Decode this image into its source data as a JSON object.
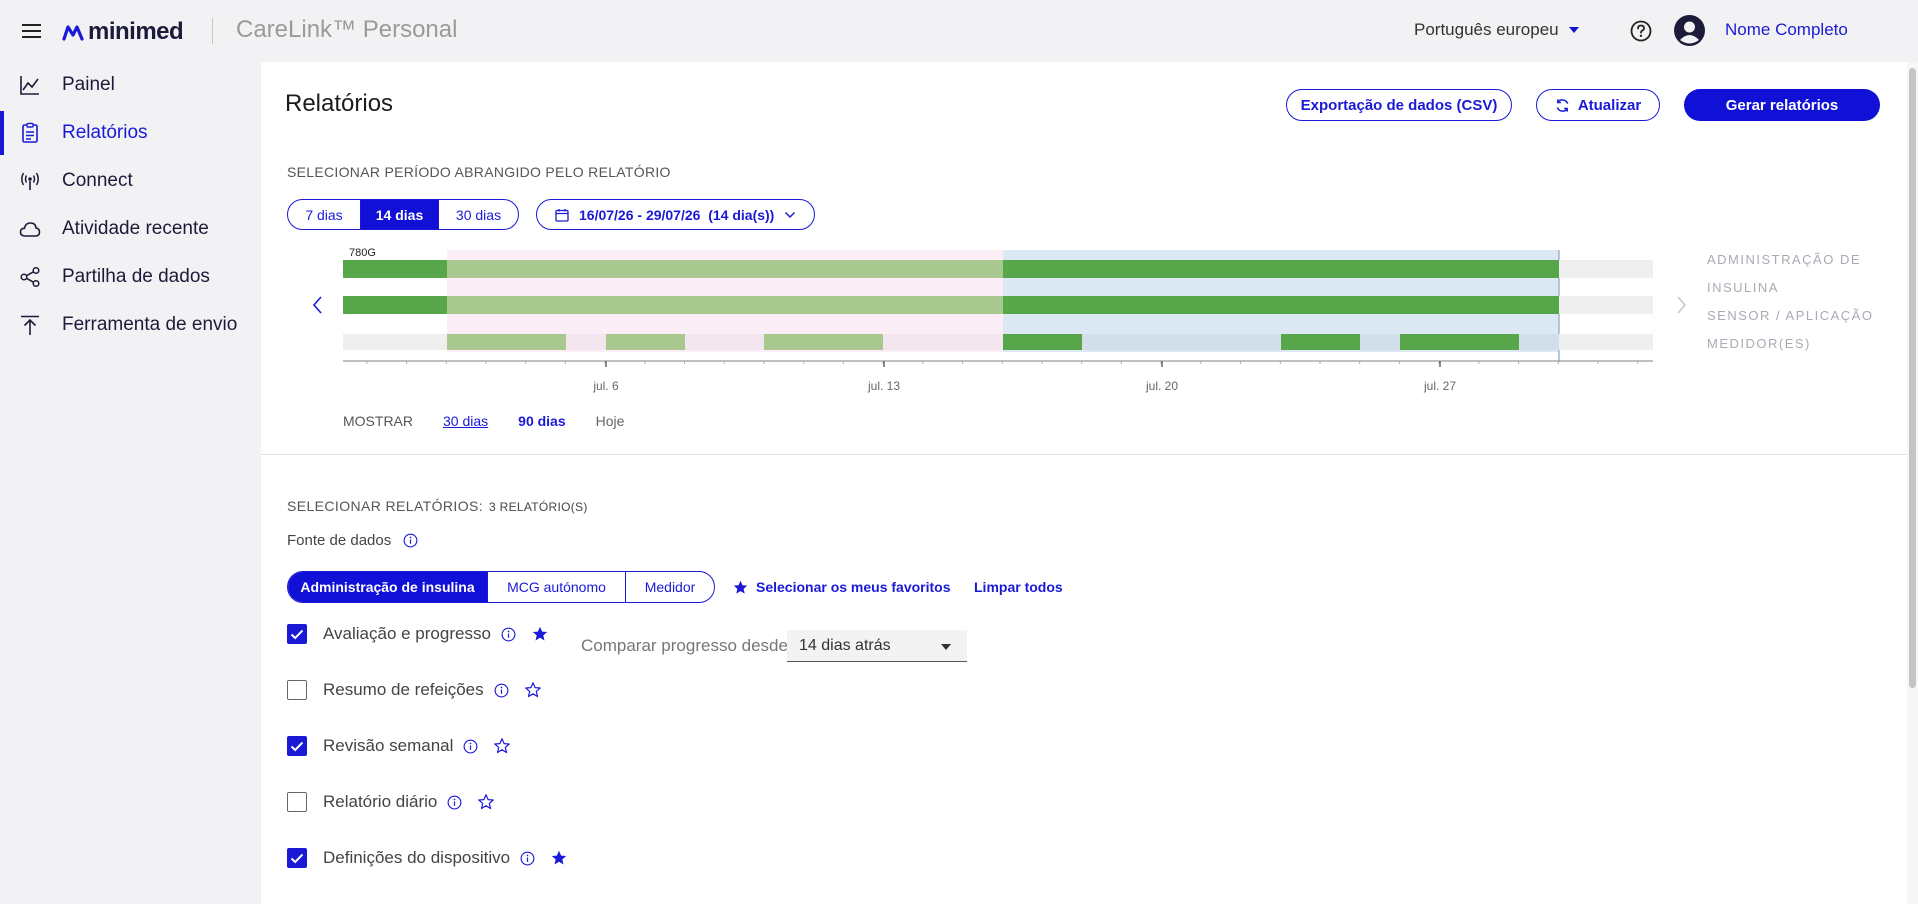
{
  "header": {
    "brand": "minimed",
    "app_title": "CareLink™ Personal",
    "language": "Português europeu",
    "user_name": "Nome Completo"
  },
  "sidebar": {
    "items": [
      {
        "label": "Painel",
        "icon": "chart-line-icon"
      },
      {
        "label": "Relatórios",
        "icon": "clipboard-icon",
        "active": true
      },
      {
        "label": "Connect",
        "icon": "broadcast-icon"
      },
      {
        "label": "Atividade recente",
        "icon": "cloud-icon"
      },
      {
        "label": "Partilha de dados",
        "icon": "share-icon"
      },
      {
        "label": "Ferramenta de envio",
        "icon": "upload-icon"
      }
    ]
  },
  "main": {
    "title": "Relatórios",
    "export_label": "Exportação de dados (CSV)",
    "refresh_label": "Atualizar",
    "generate_label": "Gerar relatórios",
    "period_section": "SELECIONAR PERÍODO ABRANGIDO PELO RELATÓRIO",
    "period_options": [
      "7 dias",
      "14 dias",
      "30 dias"
    ],
    "period_selected": "14 dias",
    "date_range": "16/07/26 - 29/07/26  (14 dia(s))",
    "timeline": {
      "device_label": "780G",
      "tick_labels": [
        "jul. 6",
        "jul. 13",
        "jul. 20",
        "jul. 27"
      ],
      "legend": [
        "ADMINISTRAÇÃO DE",
        "INSULINA",
        "SENSOR / APLICAÇÃO",
        "MEDIDOR(ES)"
      ]
    },
    "show": {
      "label": "MOSTRAR",
      "options": [
        "30 dias",
        "90 dias",
        "Hoje"
      ]
    },
    "reports_section": "SELECIONAR RELATÓRIOS:",
    "reports_count": "3 RELATÓRIO(S)",
    "data_source_label": "Fonte de dados",
    "source_tabs": [
      "Administração de insulina",
      "MCG autónomo",
      "Medidor"
    ],
    "source_selected": "Administração de insulina",
    "favorites_label": "Selecionar os meus favoritos",
    "clear_label": "Limpar todos",
    "compare_label": "Comparar progresso desde:",
    "compare_value": "14 dias atrás",
    "reports": [
      {
        "label": "Avaliação e progresso",
        "checked": true,
        "favorite": true
      },
      {
        "label": "Resumo de refeições",
        "checked": false,
        "favorite": false
      },
      {
        "label": "Revisão semanal",
        "checked": true,
        "favorite": false
      },
      {
        "label": "Relatório diário",
        "checked": false,
        "favorite": false
      },
      {
        "label": "Definições do dispositivo",
        "checked": true,
        "favorite": true
      }
    ]
  },
  "colors": {
    "accent": "#1a1ad6",
    "green": "#57a64a",
    "green_light": "#a8c890",
    "pink_bg": "#fbeef6",
    "blue_bg": "#dce9f4"
  }
}
